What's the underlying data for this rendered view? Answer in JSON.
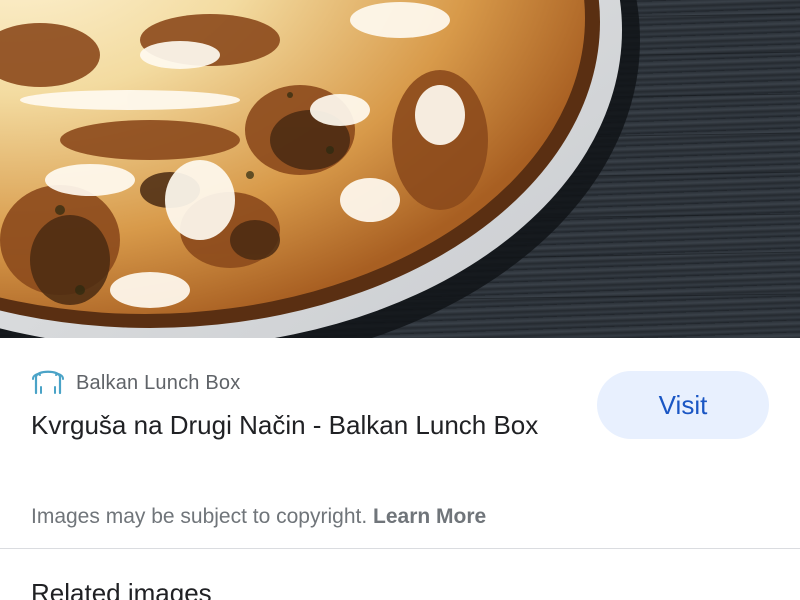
{
  "photo": {
    "subject-icon": "food-photo"
  },
  "result": {
    "source_name": "Balkan Lunch Box",
    "source_icon": "site-favicon-icon",
    "title": "Kvrguša na Drugi Način - Balkan Lunch Box",
    "visit_label": "Visit",
    "copyright_text": "Images may be subject to copyright.",
    "learn_more_label": "Learn More"
  },
  "related": {
    "heading": "Related images"
  },
  "colors": {
    "visit_bg": "#e8f0fe",
    "visit_text": "#1a56c4",
    "title_text": "#202124",
    "muted_text": "#70757a"
  }
}
